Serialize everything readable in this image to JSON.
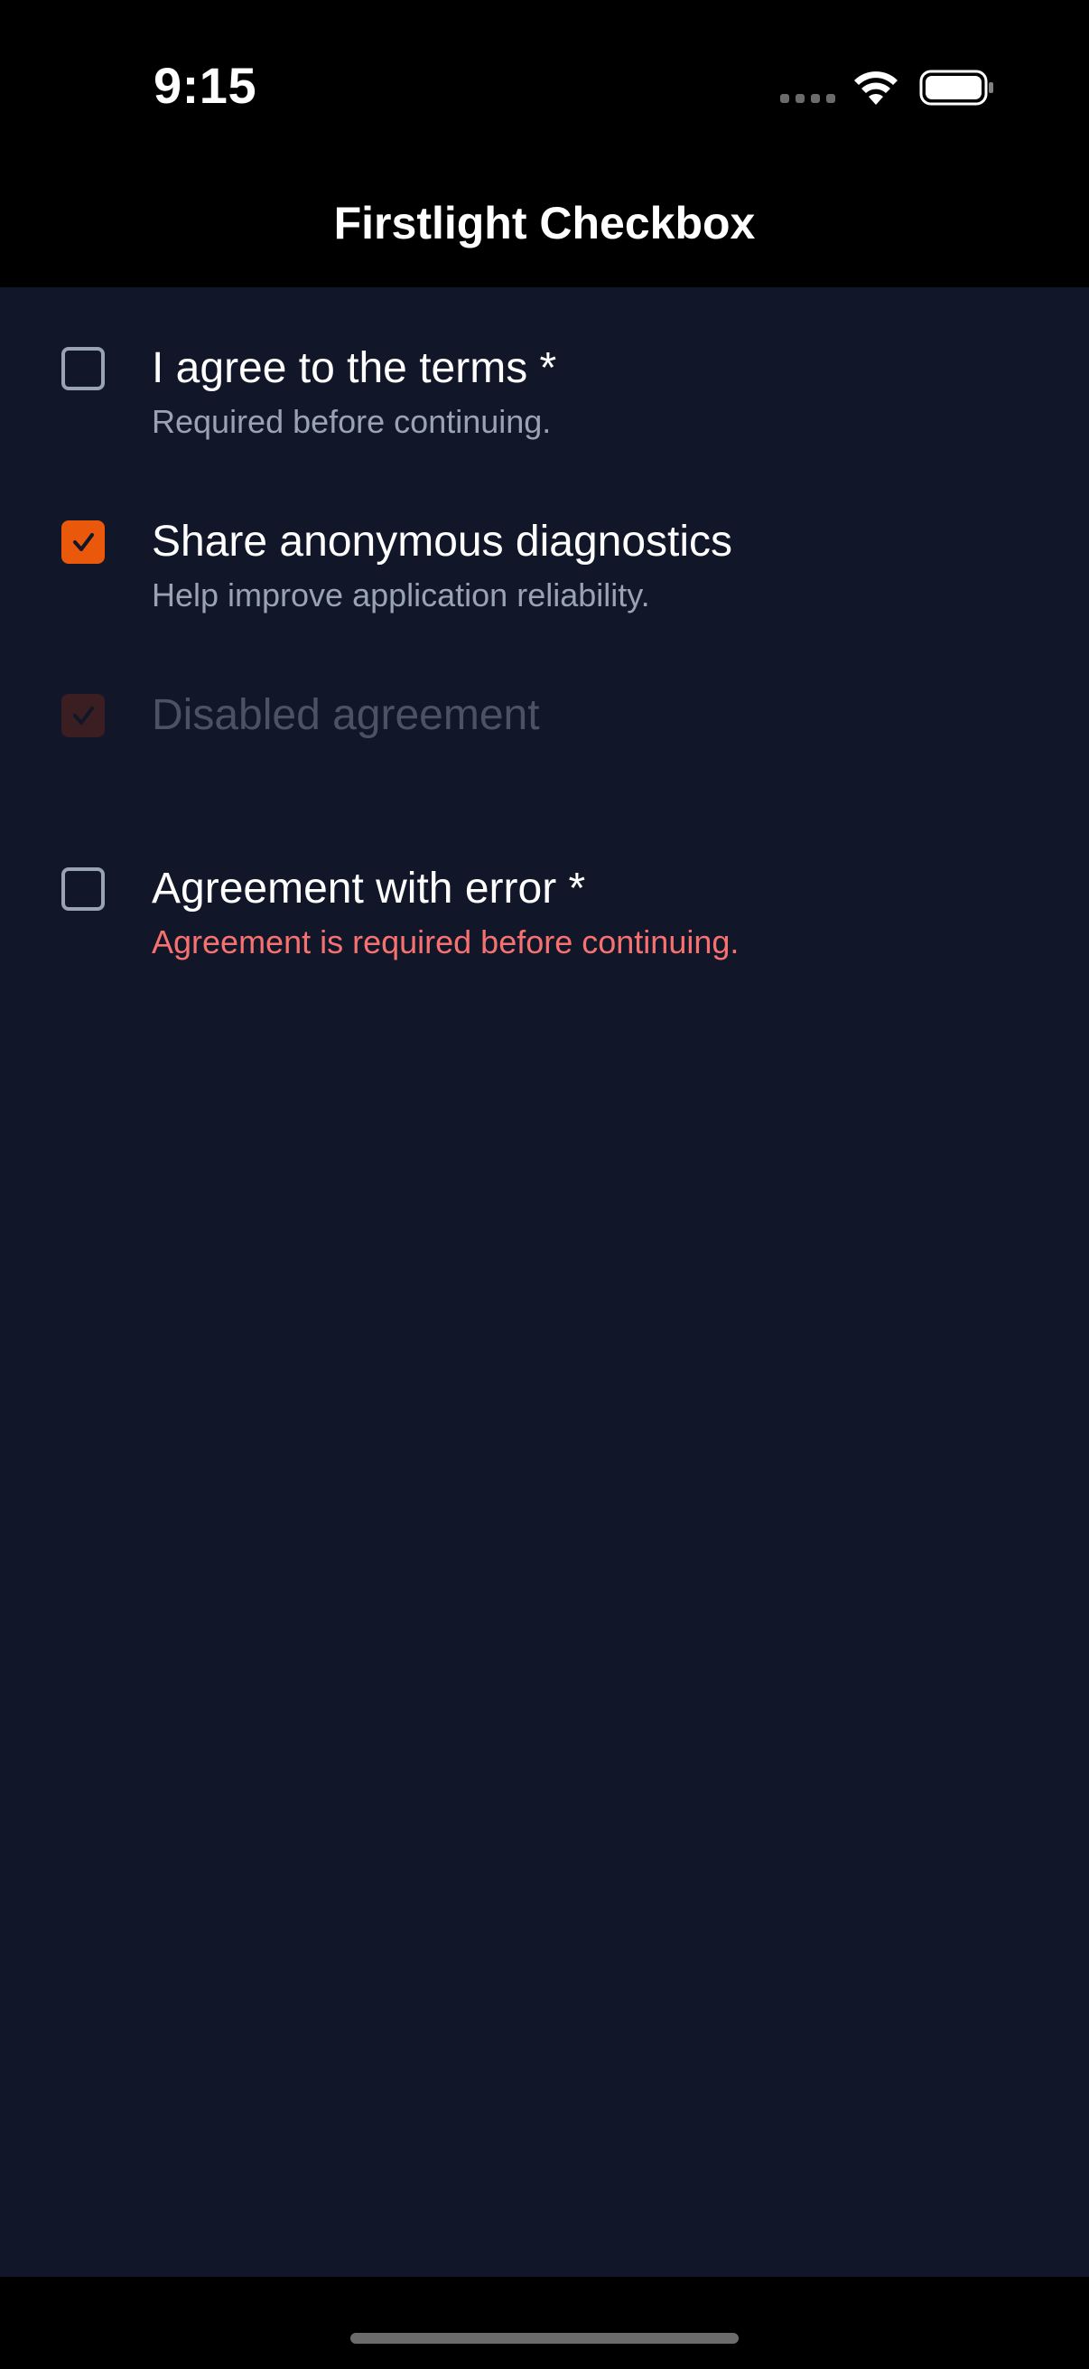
{
  "status_bar": {
    "time": "9:15"
  },
  "nav": {
    "title": "Firstlight Checkbox"
  },
  "colors": {
    "background": "#111729",
    "accent": "#EA580C",
    "error": "#F87171",
    "helper": "#9AA3B2"
  },
  "items": [
    {
      "label": "I agree to the terms *",
      "helper": "Required before continuing.",
      "checked": false,
      "disabled": false
    },
    {
      "label": "Share anonymous diagnostics",
      "helper": "Help improve application reliability.",
      "checked": true,
      "disabled": false
    },
    {
      "label": "Disabled agreement",
      "helper": "",
      "checked": true,
      "disabled": true
    },
    {
      "label": "Agreement with error *",
      "helper": "Agreement is required before continuing.",
      "checked": false,
      "disabled": false,
      "error": true
    }
  ]
}
